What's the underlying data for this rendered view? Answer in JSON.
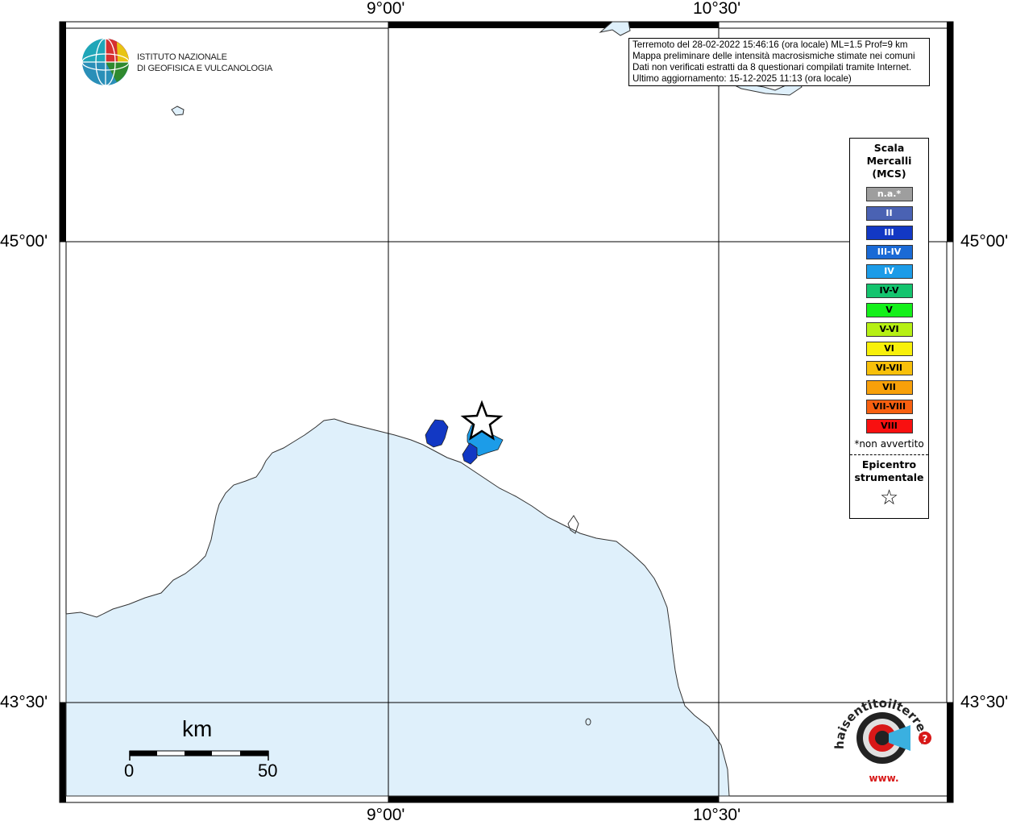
{
  "map": {
    "lat_labels": [
      "45°00'",
      "43°30'"
    ],
    "lon_labels": [
      "9°00'",
      "10°30'"
    ],
    "colors": {
      "sea": "#dff0fb",
      "land": "#ffffff",
      "coast": "#333333"
    }
  },
  "info": {
    "lines": [
      "Terremoto del 28-02-2022 15:46:16 (ora locale) ML=1.5 Prof=9 km",
      "Mappa preliminare delle intensità macrosismiche stimate nei comuni",
      "Dati non verificati estratti da 8 questionari compilati tramite Internet.",
      "Ultimo aggiornamento: 15-12-2025 11:13 (ora locale)"
    ]
  },
  "logo": {
    "line1": "ISTITUTO NAZIONALE",
    "line2": "DI GEOFISICA E VULCANOLOGIA"
  },
  "legend": {
    "title": [
      "Scala",
      "Mercalli",
      "(MCS)"
    ],
    "items": [
      {
        "label": "n.a.*",
        "color": "#9e9e9e",
        "text_color": "#ffffff"
      },
      {
        "label": "II",
        "color": "#4a62b3",
        "text_color": "#ffffff"
      },
      {
        "label": "III",
        "color": "#1238c4",
        "text_color": "#ffffff"
      },
      {
        "label": "III-IV",
        "color": "#1a6ad6",
        "text_color": "#ffffff"
      },
      {
        "label": "IV",
        "color": "#1c9ce8",
        "text_color": "#ffffff"
      },
      {
        "label": "IV-V",
        "color": "#14c46e",
        "text_color": "#000000"
      },
      {
        "label": "V",
        "color": "#14f01a",
        "text_color": "#000000"
      },
      {
        "label": "V-VI",
        "color": "#b6f014",
        "text_color": "#000000"
      },
      {
        "label": "VI",
        "color": "#f8f00a",
        "text_color": "#000000"
      },
      {
        "label": "VI-VII",
        "color": "#f8c00a",
        "text_color": "#000000"
      },
      {
        "label": "VII",
        "color": "#f8a00a",
        "text_color": "#000000"
      },
      {
        "label": "VII-VIII",
        "color": "#f86010",
        "text_color": "#000000"
      },
      {
        "label": "VIII",
        "color": "#f81010",
        "text_color": "#000000"
      }
    ],
    "note": "*non avvertito",
    "epicenter_label": [
      "Epicentro",
      "strumentale"
    ],
    "epicenter_symbol": "☆"
  },
  "scale_bar": {
    "unit": "km",
    "min": "0",
    "max": "50"
  },
  "bottom_logo": {
    "text": "haisentitoilterremoto.it",
    "www": "www."
  },
  "municipalities": [
    {
      "intensity": "III",
      "color": "#1238c4"
    },
    {
      "intensity": "IV",
      "color": "#1c9ce8"
    },
    {
      "intensity": "III",
      "color": "#1238c4"
    }
  ]
}
